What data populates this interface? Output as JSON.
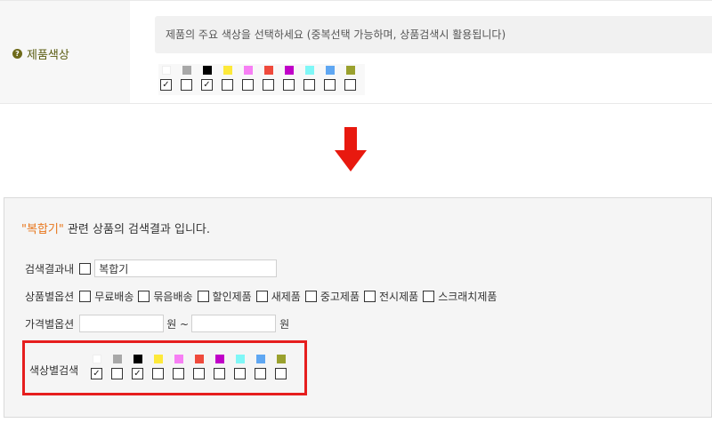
{
  "product_color": {
    "label": "제품색상",
    "help_icon": "question-icon",
    "hint": "제품의 주요 색상을 선택하세요 (중복선택 가능하며, 상품검색시 활용됩니다)",
    "colors": [
      {
        "name": "white",
        "hex": "#ffffff",
        "checked": true
      },
      {
        "name": "gray",
        "hex": "#a8a8a8",
        "checked": false
      },
      {
        "name": "black",
        "hex": "#000000",
        "checked": true
      },
      {
        "name": "yellow",
        "hex": "#fde93a",
        "checked": false
      },
      {
        "name": "pink",
        "hex": "#f77ff4",
        "checked": false
      },
      {
        "name": "red",
        "hex": "#ef4a3c",
        "checked": false
      },
      {
        "name": "purple",
        "hex": "#c000c8",
        "checked": false
      },
      {
        "name": "cyan",
        "hex": "#7ff7f7",
        "checked": false
      },
      {
        "name": "blue",
        "hex": "#5fa7f2",
        "checked": false
      },
      {
        "name": "olive",
        "hex": "#9aa12e",
        "checked": false
      }
    ]
  },
  "arrow": {
    "icon": "arrow-down-icon",
    "color": "#e8190f"
  },
  "result": {
    "keyword": "\"복합기\"",
    "title_rest": " 관련 상품의 검색결과 입니다.",
    "within_label": "검색결과내",
    "within_value": "복합기",
    "options_label": "상품별옵션",
    "options": [
      "무료배송",
      "묶음배송",
      "할인제품",
      "새제품",
      "중고제품",
      "전시제품",
      "스크래치제품"
    ],
    "price_label": "가격별옵션",
    "won_tilde": "원 ~",
    "won": "원",
    "color_label": "색상별검색",
    "colors": [
      {
        "name": "white",
        "hex": "#ffffff",
        "checked": true
      },
      {
        "name": "gray",
        "hex": "#a8a8a8",
        "checked": false
      },
      {
        "name": "black",
        "hex": "#000000",
        "checked": true
      },
      {
        "name": "yellow",
        "hex": "#fde93a",
        "checked": false
      },
      {
        "name": "pink",
        "hex": "#f77ff4",
        "checked": false
      },
      {
        "name": "red",
        "hex": "#ef4a3c",
        "checked": false
      },
      {
        "name": "purple",
        "hex": "#c000c8",
        "checked": false
      },
      {
        "name": "cyan",
        "hex": "#7ff7f7",
        "checked": false
      },
      {
        "name": "blue",
        "hex": "#5fa7f2",
        "checked": false
      },
      {
        "name": "olive",
        "hex": "#9aa12e",
        "checked": false
      }
    ],
    "highlight_color": "#e61e1e"
  }
}
